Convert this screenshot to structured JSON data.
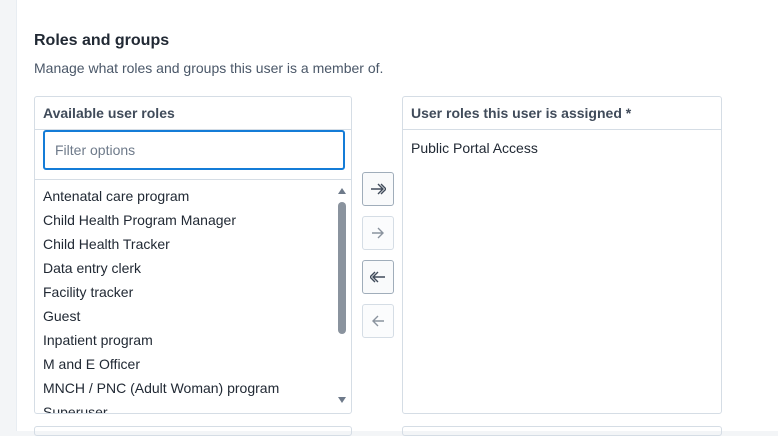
{
  "section": {
    "title": "Roles and groups",
    "description": "Manage what roles and groups this user is a member of."
  },
  "available": {
    "header": "Available user roles",
    "filter_placeholder": "Filter options",
    "filter_value": "",
    "items": [
      "Antenatal care program",
      "Child Health Program Manager",
      "Child Health Tracker",
      "Data entry clerk",
      "Facility tracker",
      "Guest",
      "Inpatient program",
      "M and E Officer",
      "MNCH / PNC (Adult Woman) program",
      "Superuser"
    ]
  },
  "assigned": {
    "header": "User roles this user is assigned *",
    "items": [
      "Public Portal Access"
    ]
  },
  "transfer_buttons": [
    {
      "name": "add-all",
      "icon": "double-chevron-right-icon",
      "enabled": true
    },
    {
      "name": "add-selected",
      "icon": "arrow-right-icon",
      "enabled": false
    },
    {
      "name": "remove-all",
      "icon": "double-chevron-left-icon",
      "enabled": true
    },
    {
      "name": "remove-selected",
      "icon": "arrow-left-icon",
      "enabled": false
    }
  ],
  "colors": {
    "focus_border": "#147cd7",
    "border": "#d5dde5",
    "text": "#212934"
  }
}
